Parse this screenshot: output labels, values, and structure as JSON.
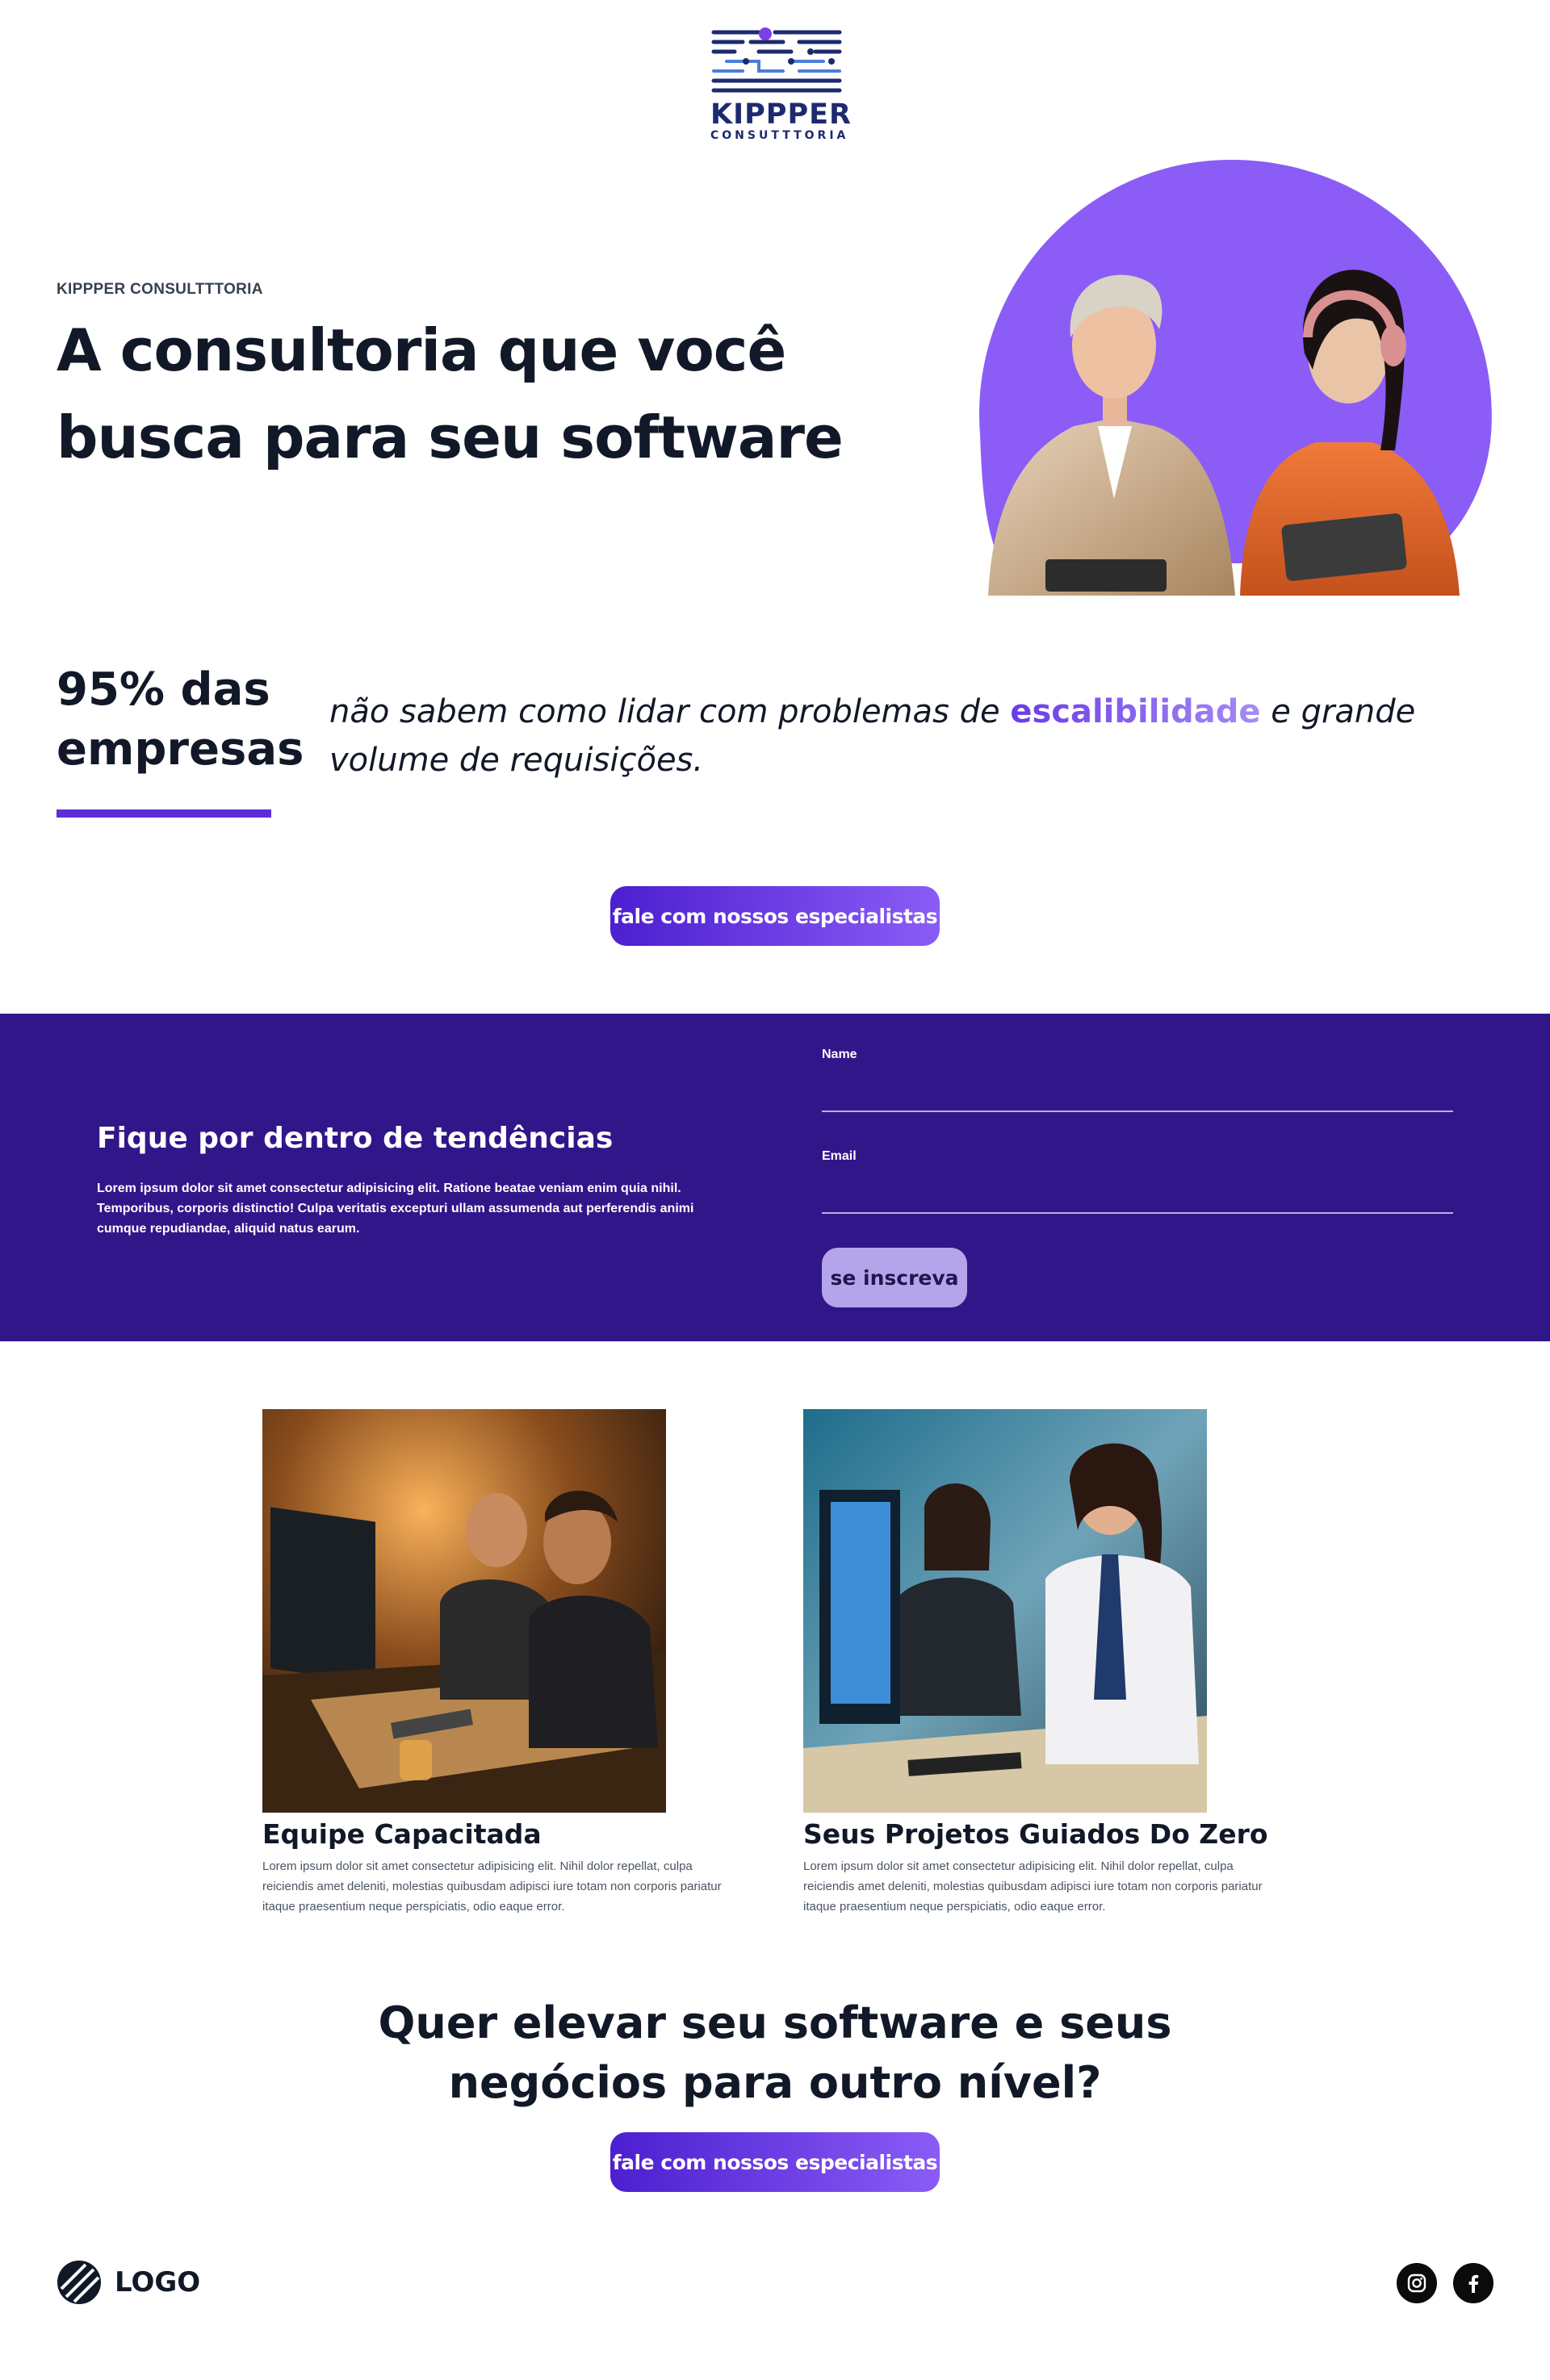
{
  "brand": {
    "logo_name": "KIPPPER",
    "logo_sub": "CONSUTTTORIA"
  },
  "hero": {
    "eyebrow": "KIPPPER CONSULTTTORIA",
    "title": "A consultoria que você busca para seu software"
  },
  "stat": {
    "number": "95% das empresas",
    "text_before": "não sabem como lidar com problemas de ",
    "text_accent": "escalibilidade",
    "text_after": " e grande volume de requisições."
  },
  "cta": {
    "button_label": "fale com nossos especialistas"
  },
  "newsletter": {
    "title": "Fique por dentro de tendências",
    "description": "Lorem ipsum dolor sit amet consectetur adipisicing elit. Ratione beatae veniam enim quia nihil. Temporibus, corporis distinctio! Culpa veritatis excepturi ullam assumenda aut perferendis animi cumque repudiandae, aliquid natus earum.",
    "name_label": "Name",
    "name_value": "",
    "email_label": "Email",
    "email_value": "",
    "submit_label": "se inscreva"
  },
  "features": [
    {
      "title": "Equipe Capacitada",
      "description": "Lorem ipsum dolor sit amet consectetur adipisicing elit. Nihil dolor repellat, culpa reiciendis amet deleniti, molestias quibusdam adipisci iure totam non corporis pariatur itaque praesentium neque perspiciatis, odio eaque error."
    },
    {
      "title": "Seus Projetos Guiados Do Zero",
      "description": "Lorem ipsum dolor sit amet consectetur adipisicing elit. Nihil dolor repellat, culpa reiciendis amet deleniti, molestias quibusdam adipisci iure totam non corporis pariatur itaque praesentium neque perspiciatis, odio eaque error."
    }
  ],
  "bottom_cta": {
    "title": "Quer elevar seu software e seus negócios para outro nível?",
    "button_label": "fale com nossos especialistas"
  },
  "footer": {
    "logo_text": "LOGO",
    "social": [
      "instagram-icon",
      "facebook-icon"
    ]
  },
  "colors": {
    "accent": "#5b2ed8",
    "newsletter_bg": "#31168a",
    "hero_circle": "#8b5cf6"
  }
}
